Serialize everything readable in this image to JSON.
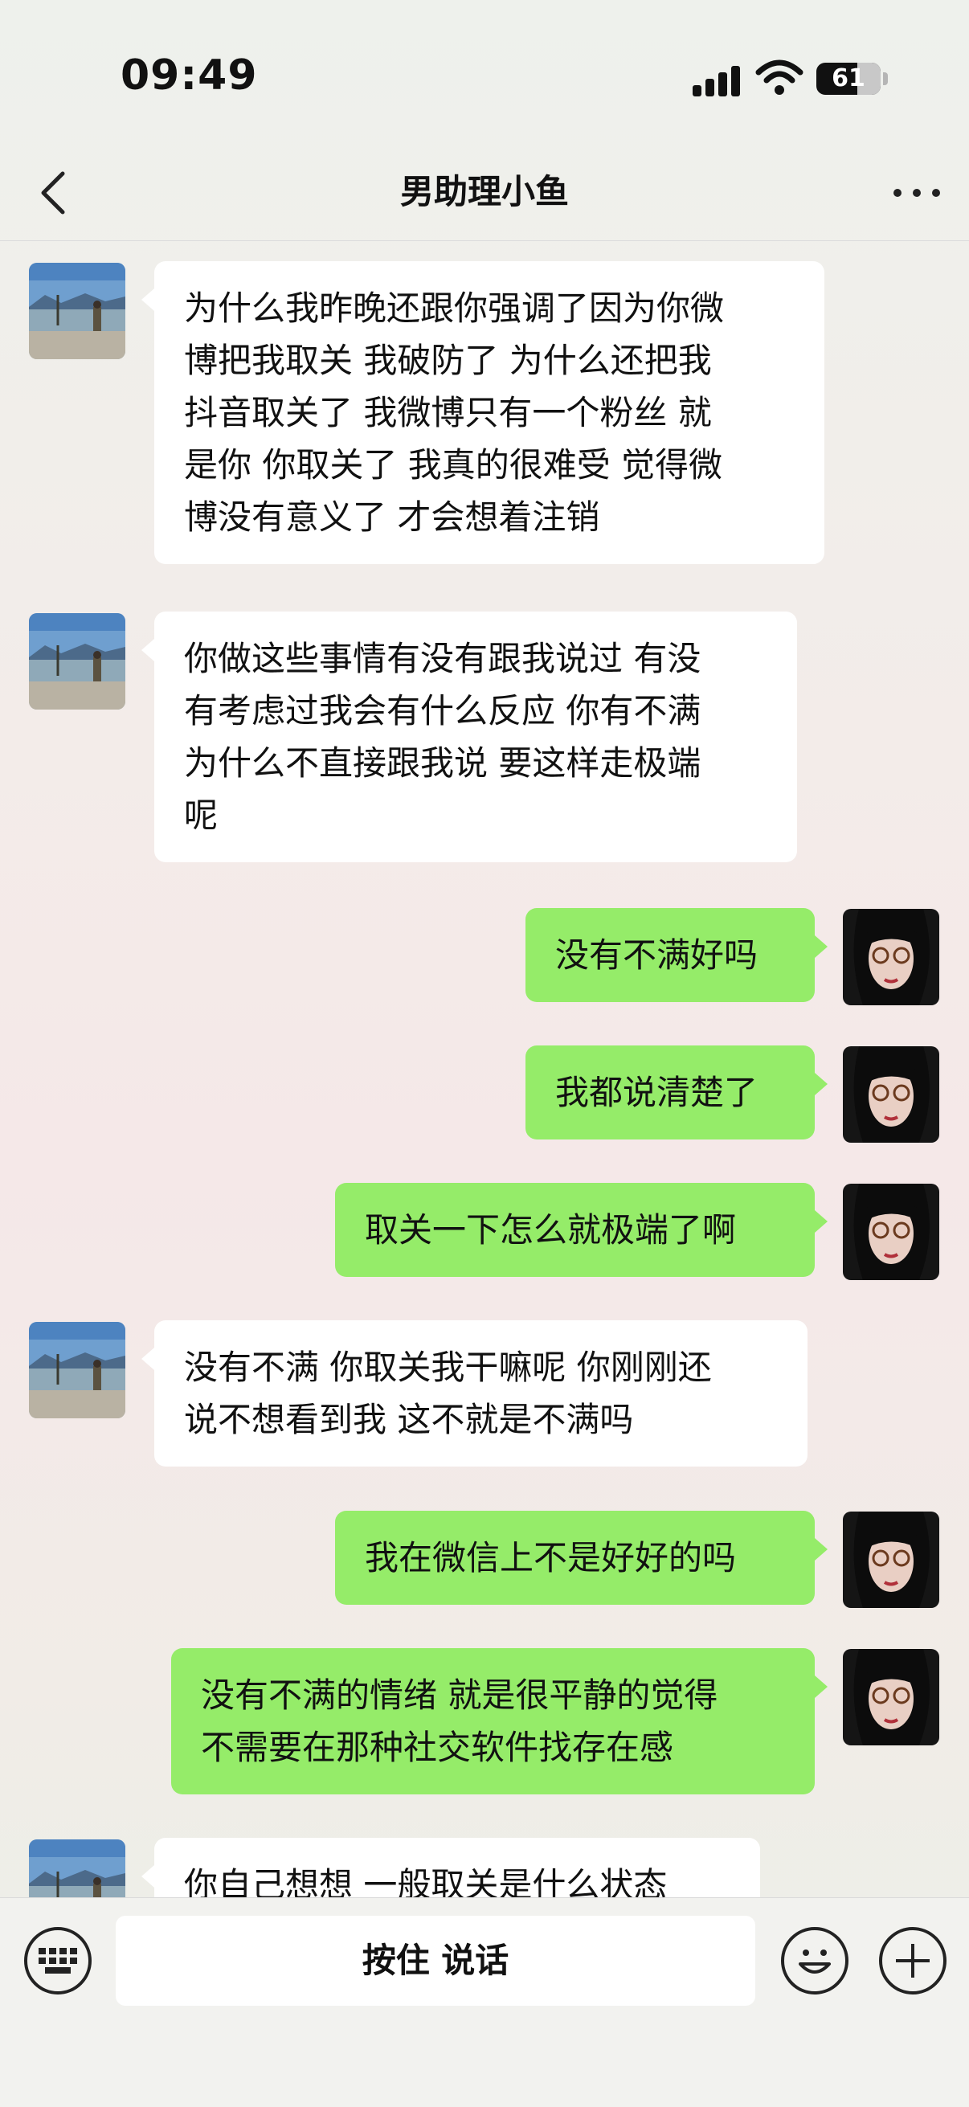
{
  "status_bar": {
    "time": "09:49",
    "battery": "61",
    "icons": [
      "signal-icon",
      "wifi-icon",
      "battery-icon"
    ]
  },
  "nav": {
    "title": "男助理小鱼",
    "back_icon": "chevron-left-icon",
    "more_icon": "more-icon"
  },
  "messages": [
    {
      "from": "other",
      "text": "为什么我昨晚还跟你强调了因为你微\n博把我取关 我破防了 为什么还把我\n抖音取关了 我微博只有一个粉丝 就\n是你 你取关了 我真的很难受 觉得微\n博没有意义了  才会想着注销"
    },
    {
      "from": "other",
      "text": "你做这些事情有没有跟我说过 有没\n有考虑过我会有什么反应 你有不满\n为什么不直接跟我说 要这样走极端\n呢"
    },
    {
      "from": "self",
      "text": "没有不满好吗"
    },
    {
      "from": "self",
      "text": "我都说清楚了"
    },
    {
      "from": "self",
      "text": "取关一下怎么就极端了啊"
    },
    {
      "from": "other",
      "text": "没有不满 你取关我干嘛呢 你刚刚还\n说不想看到我 这不就是不满吗"
    },
    {
      "from": "self",
      "text": "我在微信上不是好好的吗"
    },
    {
      "from": "self",
      "text": "没有不满的情绪 就是很平静的觉得\n不需要在那种社交软件找存在感"
    },
    {
      "from": "other",
      "text": "你自己想想 一般取关是什么状态"
    }
  ],
  "input_bar": {
    "voice_label": "按住 说话",
    "icons": [
      "keyboard-icon",
      "emoji-icon",
      "plus-icon"
    ]
  },
  "colors": {
    "sent_bubble": "#95ec69",
    "received_bubble": "#ffffff"
  }
}
